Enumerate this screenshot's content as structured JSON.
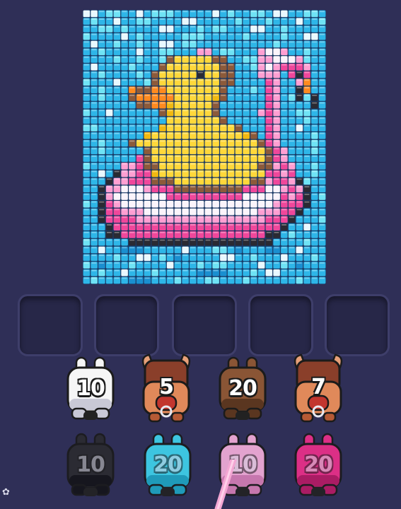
{
  "palette": {
    "background": "#2f2f57",
    "water_light": "#6fe3f5",
    "water": "#2eb6e8",
    "water_white": "#e8f8ff",
    "water_dark": "#1a8fd0",
    "outline_dark": "#2a2a33",
    "duck_yellow": "#ffd83a",
    "duck_shade": "#f2b90f",
    "beak_orange": "#ff8a1f",
    "brown": "#8c5a3a",
    "pink": "#f0479b",
    "pink_light": "#ff9fd2",
    "white": "#fbf4fb"
  },
  "mosaic": {
    "name": "rubber-duck-on-flamingo-float",
    "cols": 32,
    "rows": 36,
    "legend": {
      ".": "water",
      "c": "water_light",
      "w": "water_white",
      "d": "water_dark",
      "k": "outline_dark",
      "y": "duck_yellow",
      "s": "duck_shade",
      "o": "beak_orange",
      "b": "brown",
      "p": "pink",
      "l": "pink_light",
      "h": "white"
    },
    "grid": [
      "ww.cc..w.ccc.....w.c..cc.ww..cc.",
      ".c..w..cc....ww.....c...c...w..c",
      "..cc.c....ww...c.cc...ww..c.....",
      "c....w.c.....ccc.....c....c..ww.",
      ".w..c..c..ww.cc..........c......",
      "..c....w..cc...ll.cc...lhhl..c..",
      "....c..c..cbyyyyybb..ccllhhhlc..",
      ".w....c...byyyyyyybb..clhlpppl..",
      "..c....c.byyyyykyybb...lll.pkp..",
      "c...w...cbyyyyyyyybb....pl..lo..",
      "..c...obbooyyyyyyyb...c.pl..ko..",
      "..c...boooooyyyyysb.....pl.ckck.",
      ".......bboosyyyyyb......pl....k.",
      "c..w......bsyyyyyb.....lpl..cc..",
      "...........yyyyyyyb.....pl...c..",
      "cc........syyyyyyyyyb...pl..w...",
      "........syyyyyyyyyyyysb.pl....c.",
      "..c...byyyyyyyyyyyyyyyybpl....c.",
      "..c.....byyyyyyyyyyyyyyybpl...c.",
      ".......pbyyyyyyyyyyyyyyybpl.....",
      "c....llpbbyyyyyyyyyyyyybblpl..c.",
      "..w.kllppsyyyyyyyyyyyyyypplp..c.",
      "...kllpppbbbyyyyyyyyyybblpplkc..",
      "..kllhhhlpppbbbbbbbbbppphhlplk..",
      "..klhhhhhhhpppppppppphhhhhplpk.c",
      "c.kplhhhhhhhhhhhhhhhhhhhhlpppk..",
      "..kpplllhhhhhhhhhhhhhhhlllppk...",
      "..kpppplllllllllllllllllpppk...c",
      "...kppppppppppppppppppppppk..w..",
      "...kkpppppppppppppppppppkk.c....",
      "c.....kkkkkkkkkkkkkkkkkkk....c..",
      "..w..ddd.....w...cc.d...dd..w...",
      "....c..ww.c.d.....ww..c...w...c.",
      "c.d...c....w...c.cc....w..c.d...",
      "..c..w...c.....dddd...c.ww......",
      ".c....ddd...c...cc...c......c..."
    ]
  },
  "slots": [
    {
      "id": 1,
      "state": "empty"
    },
    {
      "id": 2,
      "state": "empty"
    },
    {
      "id": 3,
      "state": "empty"
    },
    {
      "id": 4,
      "state": "empty"
    },
    {
      "id": 5,
      "state": "empty"
    }
  ],
  "pieces": [
    {
      "type": "bunny",
      "color": "#f6f6f6",
      "shade": "#c9c9d6",
      "count": "10",
      "dim": false
    },
    {
      "type": "bull",
      "color": "#e0895a",
      "shade": "#b65a35",
      "count": "5",
      "dim": false
    },
    {
      "type": "bunny",
      "color": "#8a5535",
      "shade": "#5a3620",
      "count": "20",
      "dim": false
    },
    {
      "type": "bull",
      "color": "#e0895a",
      "shade": "#b65a35",
      "count": "7",
      "dim": false
    },
    {
      "type": "bunny",
      "color": "#2b2b30",
      "shade": "#141418",
      "count": "10",
      "dim": true
    },
    {
      "type": "bunny",
      "color": "#3fd6ef",
      "shade": "#1ea6c4",
      "count": "20",
      "dim": true
    },
    {
      "type": "bunny",
      "color": "#f7b0dc",
      "shade": "#d77fb8",
      "count": "10",
      "dim": true
    },
    {
      "type": "bunny",
      "color": "#ef2f8c",
      "shade": "#b81a66",
      "count": "20",
      "dim": true
    }
  ],
  "corner_icon": "settings-flower-icon"
}
